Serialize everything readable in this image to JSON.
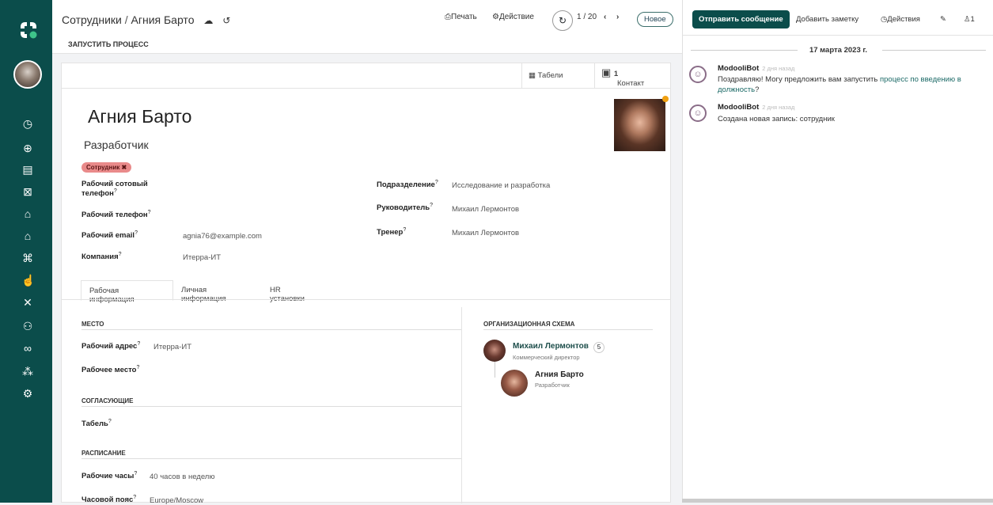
{
  "breadcrumb": {
    "parent": "Сотрудники",
    "sep": " / ",
    "current": "Агния Барто"
  },
  "header": {
    "run_process": "ЗАПУСТИТЬ ПРОЦЕСС",
    "print": "Печать",
    "action": "Действие",
    "pager": "1 / 20",
    "new": "Новое"
  },
  "stats": {
    "timesheets": "Табели",
    "contacts_count": "1",
    "contacts": "Контакт"
  },
  "employee": {
    "name": "Агния Барто",
    "job": "Разработчик",
    "tag": "Сотрудник ✖"
  },
  "fields": {
    "mobile_label1": "Рабочий сотовый",
    "mobile_label2": "телефон",
    "phone_label": "Рабочий телефон",
    "email_label": "Рабочий email",
    "email": "agnia76@example.com",
    "company_label": "Компания",
    "company": "Итерра-ИТ",
    "dept_label": "Подразделение",
    "dept": "Исследование и разработка",
    "manager_label": "Руководитель",
    "manager": "Михаил Лермонтов",
    "coach_label": "Тренер",
    "coach": "Михаил Лермонтов",
    "q": "?"
  },
  "tabs": [
    "Рабочая информация",
    "Личная информация",
    "HR установки"
  ],
  "work": {
    "place_h": "МЕСТО",
    "addr_label": "Рабочий адрес",
    "addr": "Итерра-ИТ",
    "loc_label": "Рабочее место",
    "appr_h": "СОГЛАСУЮЩИЕ",
    "ts_label": "Табель",
    "sched_h": "РАСПИСАНИЕ",
    "hours_label": "Рабочие часы",
    "hours": "40 часов в неделю",
    "tz_label": "Часовой пояс",
    "tz": "Europe/Moscow"
  },
  "org": {
    "title": "ОРГАНИЗАЦИОННАЯ СХЕМА",
    "boss_name": "Михаил Лермонтов",
    "boss_job": "Коммерческий директор",
    "boss_count": "5",
    "me_name": "Агния Барто",
    "me_job": "Разработчик"
  },
  "chatter": {
    "send": "Отправить сообщение",
    "note": "Добавить заметку",
    "actions": "Действия",
    "followers": "1",
    "date": "17 марта 2023 г.",
    "messages": [
      {
        "author": "ModooliBot",
        "ago": "2 дня назад",
        "text_a": "Поздравляю! Могу предложить вам запустить ",
        "link": "процесс по введению в должность",
        "text_b": "?"
      },
      {
        "author": "ModooliBot",
        "ago": "2 дня назад",
        "text": "Создана новая запись: сотрудник"
      }
    ]
  },
  "colors": {
    "sidebar": "#0b4d4b",
    "accent": "#1c6a67",
    "tag": "#e98a8a"
  }
}
